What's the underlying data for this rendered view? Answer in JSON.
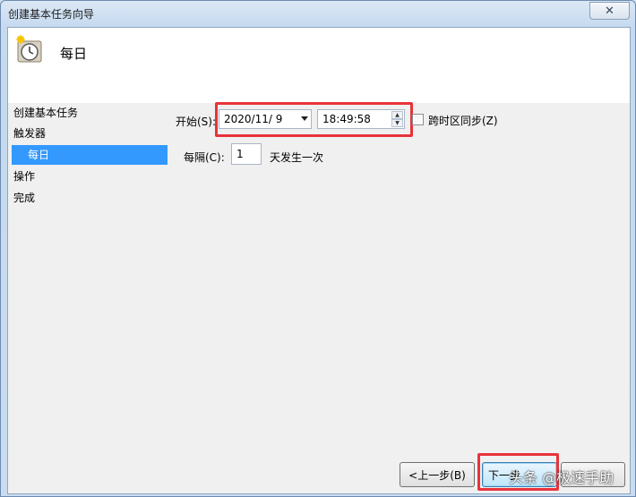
{
  "window": {
    "title": "创建基本任务向导",
    "close_glyph": "✕"
  },
  "header": {
    "title": "每日"
  },
  "steps": [
    {
      "label": "创建基本任务"
    },
    {
      "label": "触发器"
    },
    {
      "label": "每日"
    },
    {
      "label": "操作"
    },
    {
      "label": "完成"
    }
  ],
  "form": {
    "start_label": "开始(S):",
    "date_value": "2020/11/  9",
    "time_value": "18:49:58",
    "sync_label": "跨时区同步(Z)",
    "sync_checked": false,
    "recur_label": "每隔(C):",
    "recur_value": "1",
    "recur_suffix": "天发生一次"
  },
  "buttons": {
    "back": "<上一步(B)",
    "next": "下一步"
  },
  "watermark": "头条 @极速手助",
  "colors": {
    "highlight": "#3399ff",
    "annotation": "#e8333a"
  }
}
